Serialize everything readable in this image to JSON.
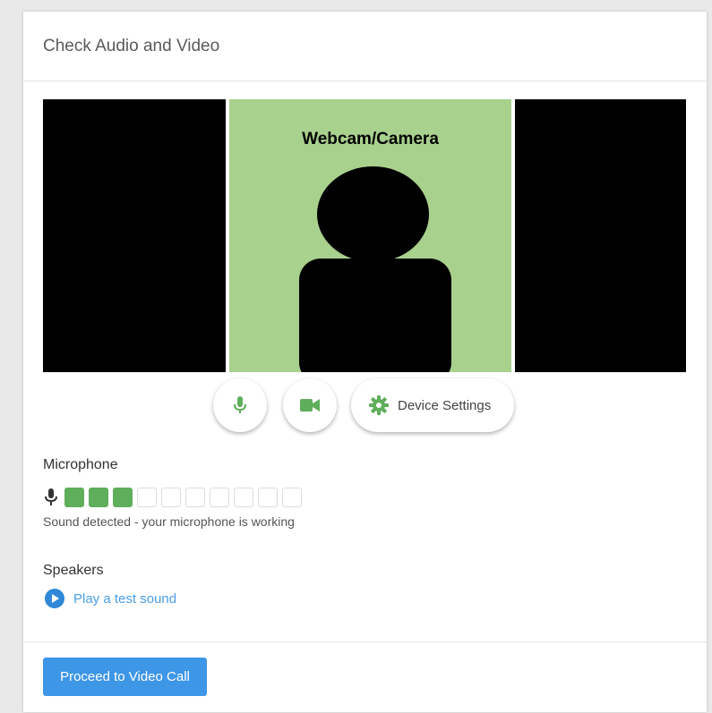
{
  "header": {
    "title": "Check Audio and Video"
  },
  "webcam": {
    "label": "Webcam/Camera"
  },
  "controls": {
    "mic_icon": "mic-icon",
    "camera_icon": "videocam-icon",
    "settings_icon": "gear-icon",
    "settings_label": "Device Settings"
  },
  "microphone": {
    "label": "Microphone",
    "level_segments_total": 10,
    "level_segments_active": 3,
    "status": "Sound detected - your microphone is working"
  },
  "speakers": {
    "label": "Speakers",
    "test_link": "Play a test sound"
  },
  "footer": {
    "proceed_label": "Proceed to Video Call"
  },
  "colors": {
    "accent_green": "#5fae5b",
    "webcam_bg": "#a9d18e",
    "primary_blue": "#3d96e6",
    "link_blue": "#4a9ee6"
  }
}
